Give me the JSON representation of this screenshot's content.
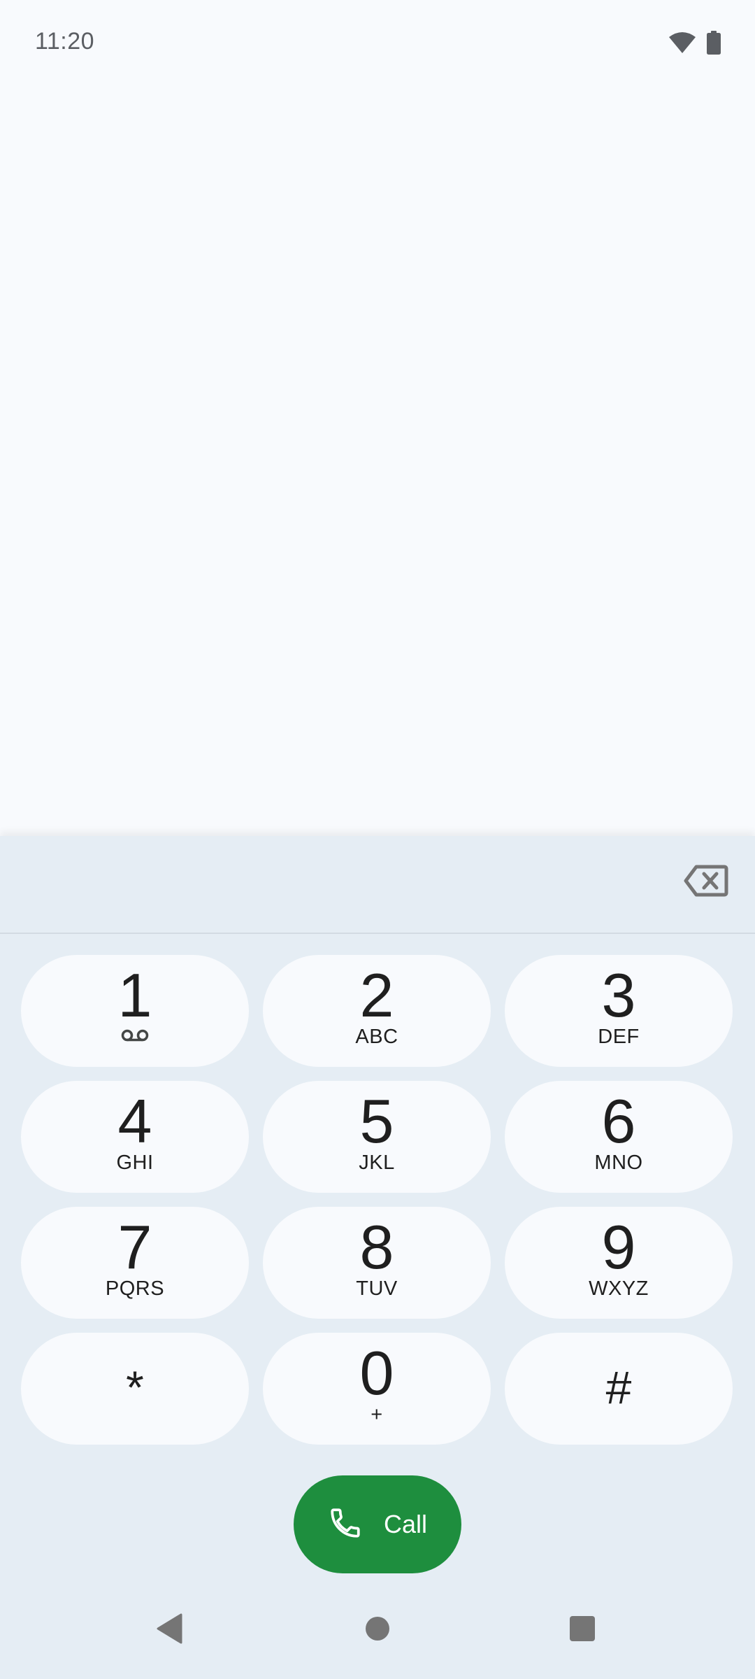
{
  "status_bar": {
    "time": "11:20",
    "icons": [
      "wifi-icon",
      "battery-icon"
    ]
  },
  "dialer": {
    "digits": "",
    "backspace_icon": "backspace-icon",
    "keys": [
      {
        "digit": "1",
        "letters": "",
        "icon": "voicemail-icon"
      },
      {
        "digit": "2",
        "letters": "ABC"
      },
      {
        "digit": "3",
        "letters": "DEF"
      },
      {
        "digit": "4",
        "letters": "GHI"
      },
      {
        "digit": "5",
        "letters": "JKL"
      },
      {
        "digit": "6",
        "letters": "MNO"
      },
      {
        "digit": "7",
        "letters": "PQRS"
      },
      {
        "digit": "8",
        "letters": "TUV"
      },
      {
        "digit": "9",
        "letters": "WXYZ"
      },
      {
        "digit": "*",
        "letters": ""
      },
      {
        "digit": "0",
        "letters": "+"
      },
      {
        "digit": "#",
        "letters": ""
      }
    ],
    "call_button": {
      "label": "Call",
      "icon": "phone-icon",
      "color": "#1e8e3e"
    }
  },
  "nav_bar": {
    "back_icon": "back-icon",
    "home_icon": "home-icon",
    "recents_icon": "recents-icon"
  },
  "colors": {
    "background": "#f8fafd",
    "dialpad_background": "#e5edf4",
    "key_background": "#f8fafd",
    "text": "#1f1f1f",
    "icon_gray": "#757575"
  }
}
